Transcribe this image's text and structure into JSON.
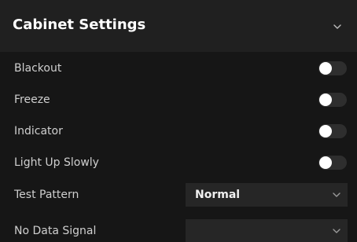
{
  "panel": {
    "title": "Cabinet Settings",
    "expand_icon": "chevron-down-icon"
  },
  "settings": {
    "blackout": {
      "label": "Blackout",
      "enabled": false
    },
    "freeze": {
      "label": "Freeze",
      "enabled": false
    },
    "indicator": {
      "label": "Indicator",
      "enabled": false
    },
    "light_up_slowly": {
      "label": "Light Up Slowly",
      "enabled": false
    },
    "test_pattern": {
      "label": "Test Pattern",
      "value": "Normal"
    },
    "no_data_signal": {
      "label": "No Data Signal",
      "value": ""
    }
  },
  "colors": {
    "background": "#161616",
    "header_background": "#202020",
    "toggle_track_off": "#2e2e2e",
    "toggle_knob": "#ffffff",
    "select_background": "#262626"
  }
}
